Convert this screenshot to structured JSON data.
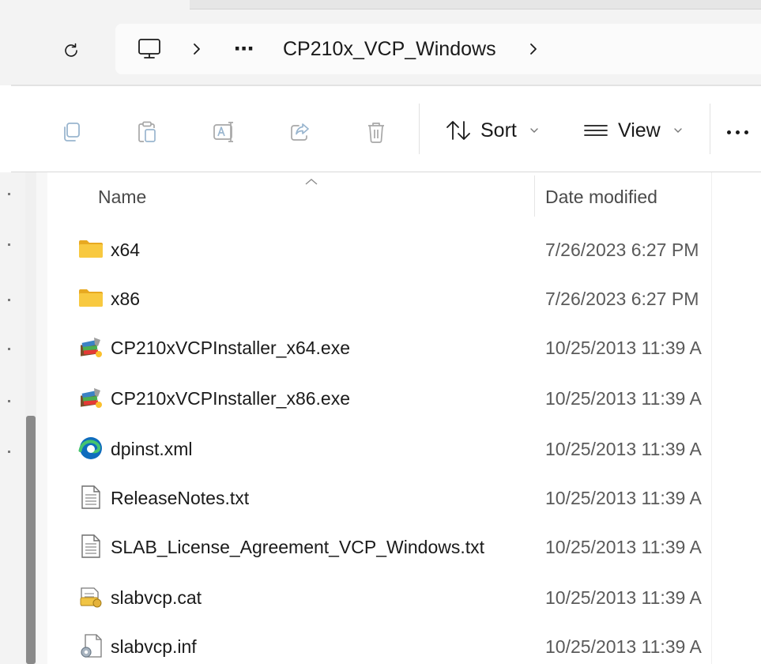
{
  "address_bar": {
    "segments": [
      "CP210x_VCP_Windows"
    ],
    "ellipsis": "⋯"
  },
  "toolbar": {
    "buttons": [
      {
        "name": "copy",
        "icon": "copy-icon"
      },
      {
        "name": "paste",
        "icon": "paste-icon"
      },
      {
        "name": "rename",
        "icon": "rename-icon"
      },
      {
        "name": "share",
        "icon": "share-icon"
      },
      {
        "name": "delete",
        "icon": "trash-icon"
      }
    ],
    "sort_label": "Sort",
    "view_label": "View"
  },
  "file_list": {
    "columns": [
      {
        "key": "name",
        "label": "Name"
      },
      {
        "key": "date_modified",
        "label": "Date modified"
      }
    ],
    "sorted_by": "name",
    "rows": [
      {
        "name": "x64",
        "date": "7/26/2023 6:27 PM",
        "icon": "folder-icon"
      },
      {
        "name": "x86",
        "date": "7/26/2023 6:27 PM",
        "icon": "folder-icon"
      },
      {
        "name": "CP210xVCPInstaller_x64.exe",
        "date": "10/25/2013 11:39 A",
        "icon": "installer-icon"
      },
      {
        "name": "CP210xVCPInstaller_x86.exe",
        "date": "10/25/2013 11:39 A",
        "icon": "installer-icon"
      },
      {
        "name": "dpinst.xml",
        "date": "10/25/2013 11:39 A",
        "icon": "edge-icon"
      },
      {
        "name": "ReleaseNotes.txt",
        "date": "10/25/2013 11:39 A",
        "icon": "text-file-icon"
      },
      {
        "name": "SLAB_License_Agreement_VCP_Windows.txt",
        "date": "10/25/2013 11:39 A",
        "icon": "text-file-icon"
      },
      {
        "name": "slabvcp.cat",
        "date": "10/25/2013 11:39 A",
        "icon": "security-catalog-icon"
      },
      {
        "name": "slabvcp.inf",
        "date": "10/25/2013 11:39 A",
        "icon": "setup-info-icon"
      }
    ]
  },
  "colors": {
    "folder": "#f8c940",
    "folder_dark": "#e8a921",
    "edge_blue": "#0f6cbd",
    "edge_green": "#46c46f",
    "chrome_bg": "#f3f3f3",
    "scroll_thumb": "#8a8a8a"
  }
}
